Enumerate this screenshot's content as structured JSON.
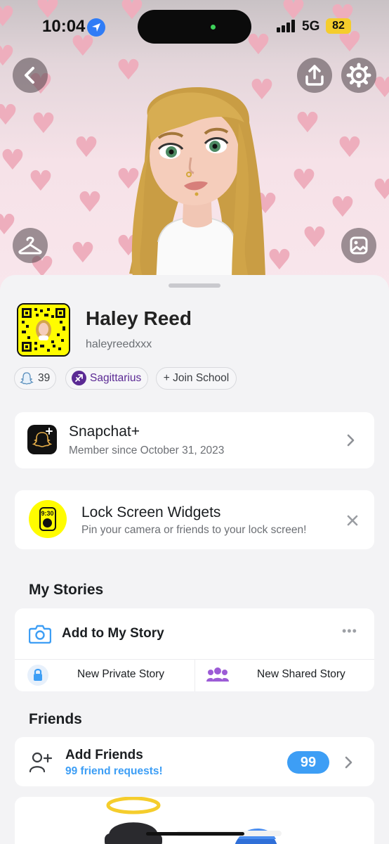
{
  "status_bar": {
    "time": "10:04",
    "network": "5G",
    "battery": "82"
  },
  "profile": {
    "display_name": "Haley Reed",
    "username": "haleyreedxxx",
    "friend_score": "39",
    "zodiac": "Sagittarius",
    "join_school": "+ Join School"
  },
  "snapchat_plus": {
    "title": "Snapchat+",
    "subtitle": "Member since October 31, 2023"
  },
  "widgets": {
    "title": "Lock Screen Widgets",
    "subtitle": "Pin your camera or friends to your lock screen!",
    "icon_time": "9:30"
  },
  "my_stories": {
    "heading": "My Stories",
    "add_label": "Add to My Story",
    "private_label": "New Private Story",
    "shared_label": "New Shared Story"
  },
  "friends": {
    "heading": "Friends",
    "add_label": "Add Friends",
    "requests_label": "99 friend requests!",
    "badge": "99"
  },
  "colors": {
    "snap_yellow": "#fffc00",
    "accent_blue": "#3d9ef5",
    "zodiac_purple": "#5b2a94",
    "banner_pink": "#f6e2e8"
  }
}
